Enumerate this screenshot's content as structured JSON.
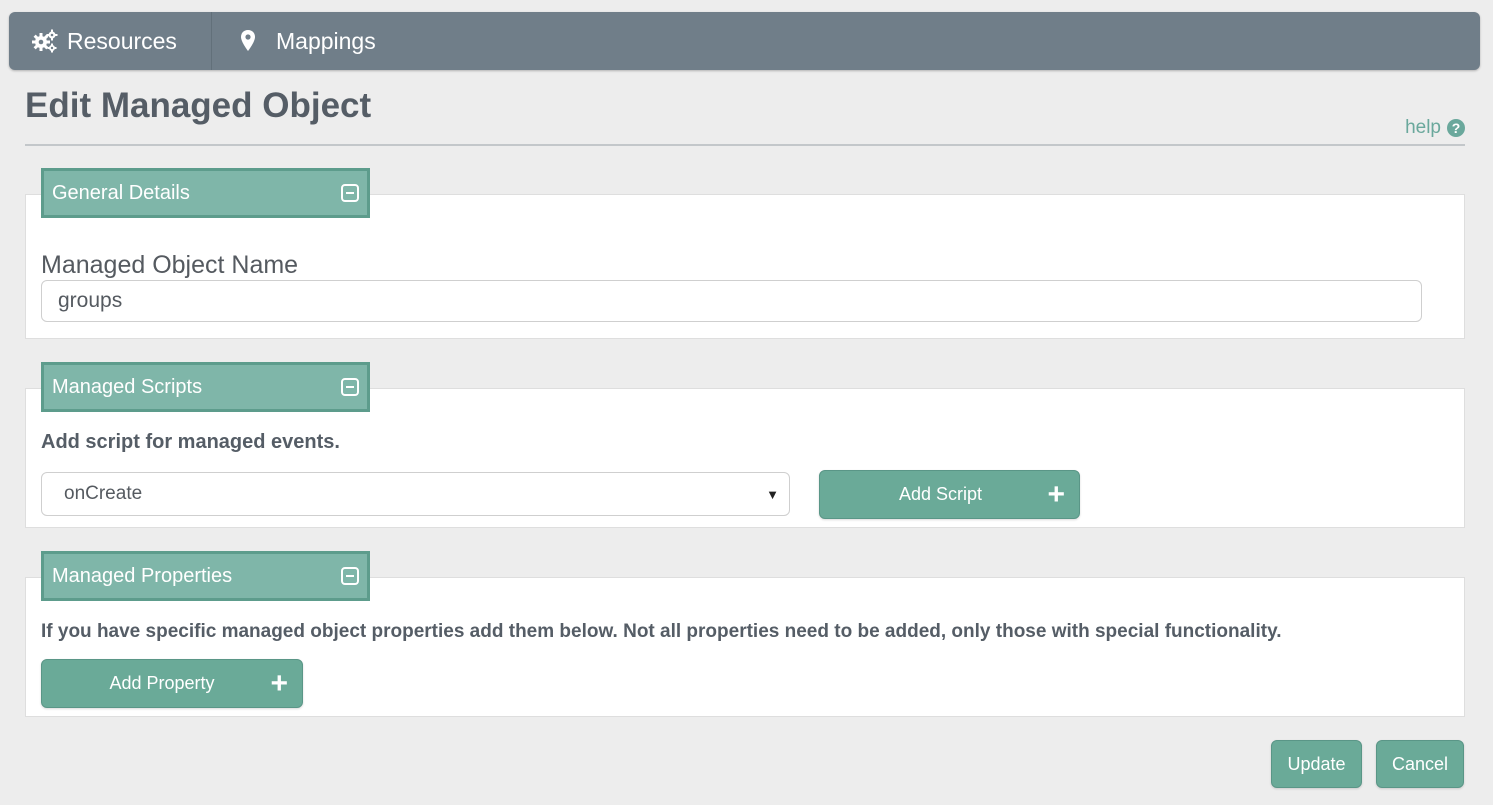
{
  "nav": {
    "resources_label": "Resources",
    "resources_icon": "gears-icon",
    "mappings_label": "Mappings",
    "mappings_icon": "map-marker-icon"
  },
  "page": {
    "title": "Edit Managed Object",
    "help_label": "help",
    "help_icon_glyph": "?"
  },
  "general_details": {
    "header": "General Details",
    "name_label": "Managed Object Name",
    "name_value": "groups"
  },
  "managed_scripts": {
    "header": "Managed Scripts",
    "description": "Add script for managed events.",
    "selected_event": "onCreate",
    "add_button": "Add Script"
  },
  "managed_properties": {
    "header": "Managed Properties",
    "description": "If you have specific managed object properties add them below. Not all properties need to be added, only those with special functionality.",
    "add_button": "Add Property"
  },
  "footer": {
    "update_label": "Update",
    "cancel_label": "Cancel"
  },
  "colors": {
    "navbar": "#707e89",
    "accent": "#6aaa98",
    "panel_header": "#7fb6a9",
    "help": "#6aa89c"
  }
}
